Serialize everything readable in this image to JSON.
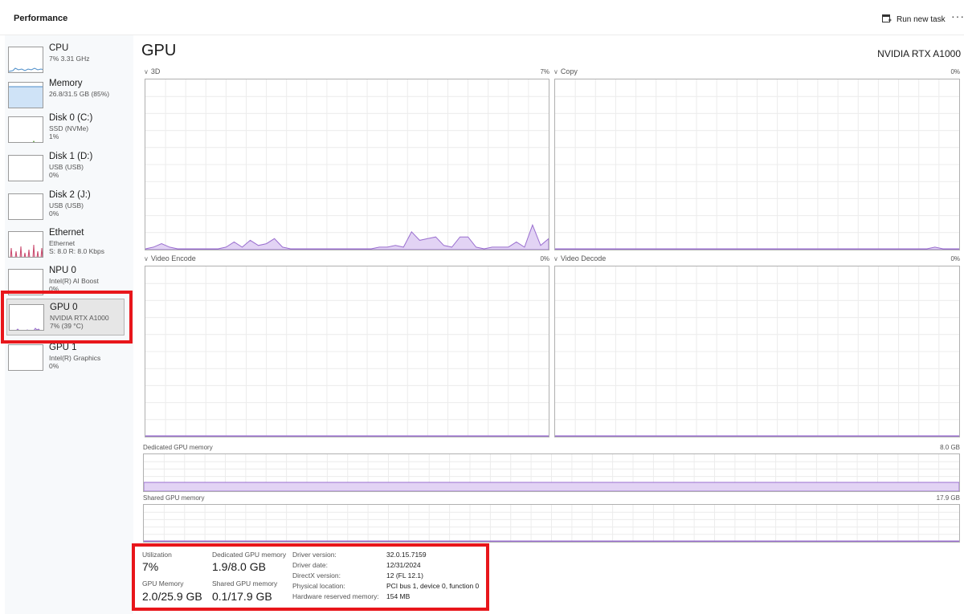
{
  "header": {
    "title": "Performance",
    "run_task_label": "Run new task",
    "more_label": "···"
  },
  "sidebar": {
    "items": [
      {
        "name": "CPU",
        "sub1": "7%  3.31 GHz",
        "sub2": ""
      },
      {
        "name": "Memory",
        "sub1": "26.8/31.5 GB (85%)",
        "sub2": ""
      },
      {
        "name": "Disk 0 (C:)",
        "sub1": "SSD (NVMe)",
        "sub2": "1%"
      },
      {
        "name": "Disk 1 (D:)",
        "sub1": "USB (USB)",
        "sub2": "0%"
      },
      {
        "name": "Disk 2 (J:)",
        "sub1": "USB (USB)",
        "sub2": "0%"
      },
      {
        "name": "Ethernet",
        "sub1": "Ethernet",
        "sub2": "S: 8.0  R: 8.0 Kbps"
      },
      {
        "name": "NPU 0",
        "sub1": "Intel(R) AI Boost",
        "sub2": "0%"
      },
      {
        "name": "GPU 0",
        "sub1": "NVIDIA RTX A1000",
        "sub2": "7% (39 °C)"
      },
      {
        "name": "GPU 1",
        "sub1": "Intel(R) Graphics",
        "sub2": "0%"
      }
    ]
  },
  "main": {
    "title": "GPU",
    "model": "NVIDIA RTX A1000",
    "graphs": [
      {
        "label": "3D",
        "percent": "7%"
      },
      {
        "label": "Copy",
        "percent": "0%"
      },
      {
        "label": "Video Encode",
        "percent": "0%"
      },
      {
        "label": "Video Decode",
        "percent": "0%"
      }
    ],
    "dedicated": {
      "label": "Dedicated GPU memory",
      "max": "8.0 GB"
    },
    "shared": {
      "label": "Shared GPU memory",
      "max": "17.9 GB"
    }
  },
  "stats": {
    "utilization_label": "Utilization",
    "utilization": "7%",
    "dedicated_label": "Dedicated GPU memory",
    "dedicated": "1.9/8.0 GB",
    "gpu_memory_label": "GPU Memory",
    "gpu_memory": "2.0/25.9 GB",
    "shared_label": "Shared GPU memory",
    "shared": "0.1/17.9 GB",
    "details": [
      {
        "key": "Driver version:",
        "value": "32.0.15.7159"
      },
      {
        "key": "Driver date:",
        "value": "12/31/2024"
      },
      {
        "key": "DirectX version:",
        "value": "12 (FL 12.1)"
      },
      {
        "key": "Physical location:",
        "value": "PCI bus 1, device 0, function 0"
      },
      {
        "key": "Hardware reserved memory:",
        "value": "154 MB"
      }
    ]
  },
  "colors": {
    "gpu_line": "#9a6fcf",
    "gpu_fill": "#e2d3f4",
    "memory_fill": "#cfe3f7",
    "cpu_line": "#4c8dc9",
    "ethernet_line": "#c9486d",
    "highlight": "#e8161b",
    "grid": "#ececec"
  },
  "levels": {
    "memory_usage_fraction": 0.85,
    "dedicated_memory_fraction": 0.2375,
    "shared_memory_fraction": 0.0056
  },
  "chart_data": {
    "type": "area",
    "series": [
      {
        "name": "3D",
        "values": [
          0,
          1,
          3,
          1,
          0,
          0,
          0,
          0,
          0,
          0,
          1,
          4,
          1,
          5,
          2,
          3,
          6,
          1,
          0,
          0,
          0,
          0,
          0,
          0,
          0,
          0,
          0,
          0,
          0,
          1,
          1,
          2,
          1,
          10,
          5,
          6,
          7,
          2,
          1,
          7,
          7,
          1,
          0,
          1,
          1,
          1,
          4,
          1,
          14,
          2,
          6
        ]
      },
      {
        "name": "Copy",
        "values": [
          0,
          0,
          0,
          0,
          0,
          0,
          0,
          0,
          0,
          0,
          0,
          0,
          0,
          0,
          0,
          0,
          0,
          0,
          0,
          0,
          0,
          0,
          0,
          0,
          0,
          0,
          0,
          0,
          0,
          0,
          0,
          0,
          0,
          0,
          0,
          0,
          0,
          0,
          0,
          0,
          0,
          0,
          0,
          0,
          0,
          0,
          0,
          1,
          0,
          0,
          0
        ]
      },
      {
        "name": "Video Encode",
        "values": [
          0,
          0,
          0,
          0,
          0,
          0,
          0,
          0,
          0,
          0,
          0,
          0,
          0,
          0,
          0,
          0,
          0,
          0,
          0,
          0,
          0,
          0,
          0,
          0,
          0,
          0,
          0,
          0,
          0,
          0,
          0,
          0,
          0,
          0,
          0,
          0,
          0,
          0,
          0,
          0,
          0,
          0,
          0,
          0,
          0,
          0,
          0,
          0,
          0,
          0,
          0
        ]
      },
      {
        "name": "Video Decode",
        "values": [
          0,
          0,
          0,
          0,
          0,
          0,
          0,
          0,
          0,
          0,
          0,
          0,
          0,
          0,
          0,
          0,
          0,
          0,
          0,
          0,
          0,
          0,
          0,
          0,
          0,
          0,
          0,
          0,
          0,
          0,
          0,
          0,
          0,
          0,
          0,
          0,
          0,
          0,
          0,
          0,
          0,
          0,
          0,
          0,
          0,
          0,
          0,
          0,
          0,
          0,
          0
        ]
      }
    ],
    "ylim": [
      0,
      100
    ]
  }
}
